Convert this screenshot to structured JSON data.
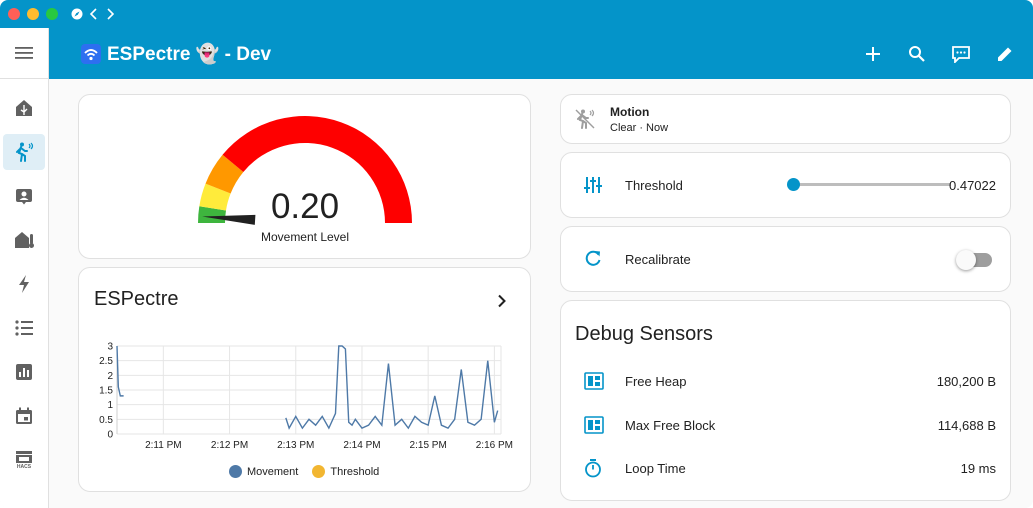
{
  "colors": {
    "primary": "#0494c9",
    "gauge_red": "#fe0000",
    "gauge_orange": "#ff9800",
    "gauge_yellow": "#ffeb3b",
    "gauge_green": "#3eb53e",
    "movement_series": "#4e79a7",
    "threshold_series": "#f2b631"
  },
  "header": {
    "title": "ESPectre 👻 - Dev",
    "title_icon": "wifi-icon"
  },
  "sidebar": {
    "items": [
      {
        "name": "overview",
        "icon": "home-icon"
      },
      {
        "name": "motion",
        "icon": "walk-icon"
      },
      {
        "name": "badge",
        "icon": "account-box-icon"
      },
      {
        "name": "climate",
        "icon": "home-thermometer-icon"
      },
      {
        "name": "energy",
        "icon": "lightning-icon"
      },
      {
        "name": "logbook",
        "icon": "list-icon"
      },
      {
        "name": "history",
        "icon": "bar-chart-icon"
      },
      {
        "name": "calendar",
        "icon": "calendar-icon"
      },
      {
        "name": "hacs",
        "icon": "hacs-icon",
        "label": "HACS"
      }
    ]
  },
  "gauge": {
    "value_text": "0.20",
    "label": "Movement Level",
    "value": 0.2
  },
  "chart": {
    "title": "ESPectre",
    "legend": [
      "Movement",
      "Threshold"
    ]
  },
  "chart_data": {
    "type": "line",
    "yticks": [
      "3",
      "2.5",
      "2",
      "1.5",
      "1",
      "0.5",
      "0"
    ],
    "xticks": [
      "2:11 PM",
      "2:12 PM",
      "2:13 PM",
      "2:14 PM",
      "2:15 PM",
      "2:16 PM"
    ],
    "ylim": [
      0,
      3
    ],
    "xlim": [
      10.3,
      16.1
    ],
    "series": [
      {
        "name": "Movement",
        "x": [
          10.3,
          10.32,
          10.35,
          10.4,
          12.85,
          12.9,
          13.0,
          13.1,
          13.2,
          13.3,
          13.4,
          13.5,
          13.6,
          13.65,
          13.7,
          13.75,
          13.8,
          13.85,
          13.9,
          14.0,
          14.1,
          14.2,
          14.3,
          14.4,
          14.5,
          14.6,
          14.7,
          14.8,
          14.9,
          15.0,
          15.1,
          15.2,
          15.3,
          15.4,
          15.5,
          15.6,
          15.7,
          15.8,
          15.9,
          16.0,
          16.05
        ],
        "y": [
          3.0,
          1.6,
          1.3,
          1.3,
          0.55,
          0.2,
          0.6,
          0.2,
          0.5,
          0.3,
          0.6,
          0.2,
          0.7,
          3.0,
          3.0,
          2.9,
          0.4,
          0.3,
          0.5,
          0.2,
          0.3,
          0.6,
          0.3,
          2.4,
          0.3,
          0.5,
          0.2,
          0.6,
          0.4,
          0.3,
          1.3,
          0.3,
          0.2,
          0.5,
          2.2,
          0.4,
          0.3,
          0.5,
          2.5,
          0.4,
          0.8
        ]
      },
      {
        "name": "Threshold",
        "x": [
          12.85,
          16.05
        ],
        "y": [
          0.47022,
          0.47022
        ]
      }
    ]
  },
  "motion": {
    "title": "Motion",
    "state": "Clear · Now"
  },
  "threshold": {
    "label": "Threshold",
    "value": "0.47022",
    "fraction": 0.0
  },
  "recalibrate": {
    "label": "Recalibrate",
    "on": false
  },
  "debug": {
    "title": "Debug Sensors",
    "rows": [
      {
        "label": "Free Heap",
        "value": "180,200 B",
        "icon": "memory-icon"
      },
      {
        "label": "Max Free Block",
        "value": "114,688 B",
        "icon": "memory-icon"
      },
      {
        "label": "Loop Time",
        "value": "19 ms",
        "icon": "timer-icon"
      }
    ]
  }
}
